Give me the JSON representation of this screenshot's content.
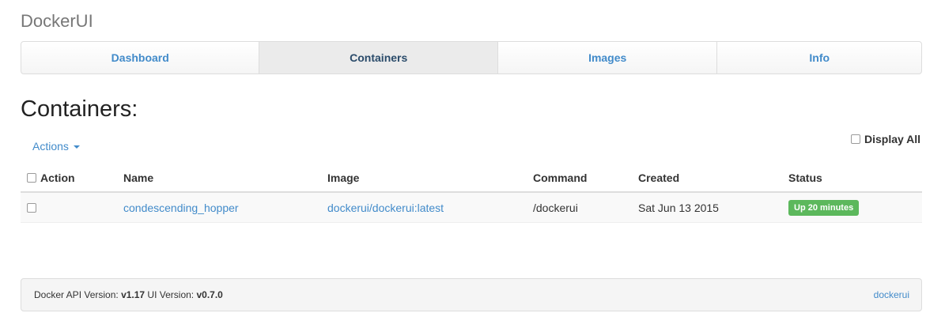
{
  "app": {
    "brand": "DockerUI"
  },
  "nav": {
    "items": [
      {
        "label": "Dashboard"
      },
      {
        "label": "Containers"
      },
      {
        "label": "Images"
      },
      {
        "label": "Info"
      }
    ],
    "active": "Containers"
  },
  "page": {
    "title": "Containers:"
  },
  "toolbar": {
    "actions_label": "Actions",
    "display_all_label": "Display All"
  },
  "table": {
    "headers": [
      "Action",
      "Name",
      "Image",
      "Command",
      "Created",
      "Status"
    ],
    "rows": [
      {
        "name": "condescending_hopper",
        "image": "dockerui/dockerui:latest",
        "command": "/dockerui",
        "created": "Sat Jun 13 2015",
        "status": "Up 20 minutes"
      }
    ]
  },
  "footer": {
    "api_label": "Docker API Version: ",
    "api_version": "v1.17",
    "ui_label": " UI Version: ",
    "ui_version": "v0.7.0",
    "link": "dockerui"
  },
  "colors": {
    "accent": "#428bca",
    "status_running": "#5cb85c"
  }
}
